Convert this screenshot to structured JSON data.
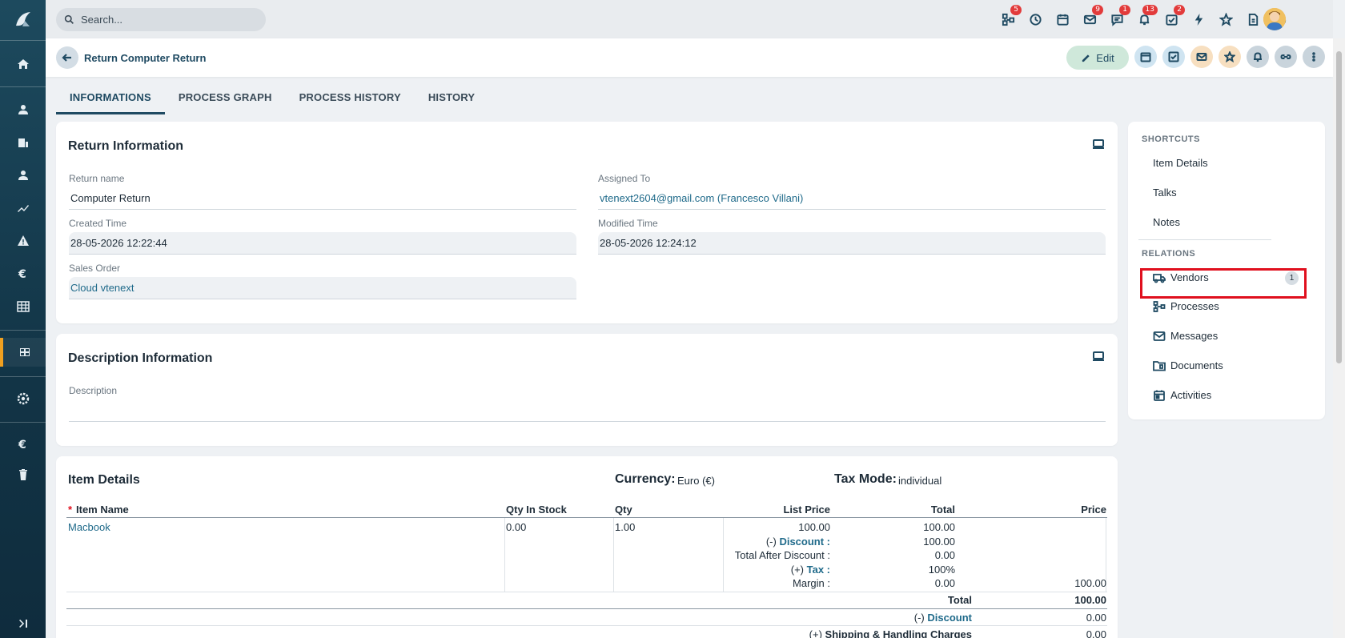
{
  "search": {
    "placeholder": "Search..."
  },
  "topbar": {
    "badges": {
      "processes": "5",
      "mail": "9",
      "talks": "1",
      "notifications": "13",
      "tasks": "2"
    }
  },
  "record": {
    "title": "Return Computer Return",
    "edit_label": "Edit"
  },
  "tabs": [
    "INFORMATIONS",
    "PROCESS GRAPH",
    "PROCESS HISTORY",
    "HISTORY"
  ],
  "return_info": {
    "title": "Return Information",
    "return_name_label": "Return name",
    "return_name": "Computer Return",
    "assigned_to_label": "Assigned To",
    "assigned_to": "vtenext2604@gmail.com (Francesco Villani)",
    "created_time_label": "Created Time",
    "created_time": "28-05-2026 12:22:44",
    "modified_time_label": "Modified Time",
    "modified_time": "28-05-2026 12:24:12",
    "sales_order_label": "Sales Order",
    "sales_order": "Cloud vtenext"
  },
  "description_info": {
    "title": "Description Information",
    "description_label": "Description",
    "description": ""
  },
  "item_details": {
    "title": "Item Details",
    "currency_label": "Currency:",
    "currency_value": "Euro (€)",
    "tax_mode_label": "Tax Mode:",
    "tax_mode_value": "individual",
    "required_mark": "*",
    "headers": {
      "item_name": "Item Name",
      "qty_in_stock": "Qty In Stock",
      "qty": "Qty",
      "list_price": "List Price",
      "total": "Total",
      "price": "Price"
    },
    "row": {
      "item_name": "Macbook",
      "qty_in_stock": "0.00",
      "qty": "1.00",
      "list_price": "100.00",
      "discount_prefix": "(-)",
      "discount_label": "Discount :",
      "total_after_discount_label": "Total After Discount :",
      "tax_prefix": "(+)",
      "tax_label": "Tax :",
      "margin_label": "Margin :",
      "total_list": "100.00",
      "total_discount": "100.00",
      "total_after_discount": "0.00",
      "total_tax": "100%",
      "total_margin": "0.00",
      "price": "100.00"
    },
    "summary": {
      "total_label": "Total",
      "total_value": "100.00",
      "discount_prefix": "(-)",
      "discount_label": "Discount",
      "discount_value": "0.00",
      "shipping_prefix": "(+)",
      "shipping_label": "Shipping & Handling Charges",
      "shipping_value": "0.00"
    }
  },
  "right_panel": {
    "shortcuts_title": "SHORTCUTS",
    "shortcuts": [
      "Item Details",
      "Talks",
      "Notes"
    ],
    "relations_title": "RELATIONS",
    "relations": [
      {
        "label": "Vendors",
        "count": "1"
      },
      {
        "label": "Processes"
      },
      {
        "label": "Messages"
      },
      {
        "label": "Documents"
      },
      {
        "label": "Activities"
      }
    ]
  }
}
